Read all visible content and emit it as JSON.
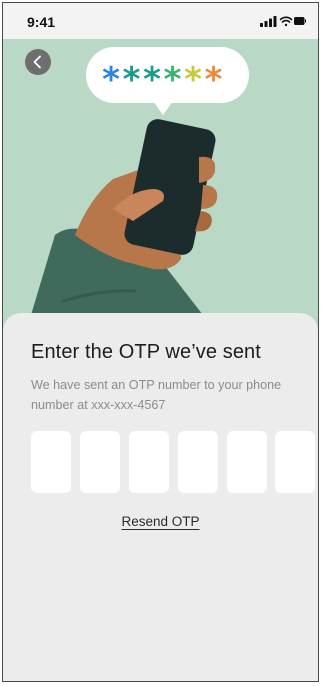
{
  "status_bar": {
    "time": "9:41"
  },
  "hero": {
    "bubble_asterisks": [
      {
        "glyph": "*",
        "color": "#2e86de"
      },
      {
        "glyph": "*",
        "color": "#1e9b8a"
      },
      {
        "glyph": "*",
        "color": "#1e9b8a"
      },
      {
        "glyph": "*",
        "color": "#3cb371"
      },
      {
        "glyph": "*",
        "color": "#c8c83a"
      },
      {
        "glyph": "*",
        "color": "#f08a3c"
      }
    ]
  },
  "sheet": {
    "title": "Enter the OTP we’ve sent",
    "subtitle": "We have sent an OTP number to your phone number at xxx-xxx-4567",
    "otp_digits": [
      "",
      "",
      "",
      "",
      "",
      ""
    ],
    "resend_label": "Resend OTP"
  },
  "colors": {
    "hero_bg": "#b9d9c6",
    "sheet_bg": "#ececec",
    "phone_screen": "#1c2b2b",
    "sleeve": "#3f6a5c",
    "hand": "#b8774a"
  },
  "icons": {
    "back": "chevron-left-icon",
    "signal": "signal-icon",
    "wifi": "wifi-icon",
    "battery": "battery-icon"
  }
}
